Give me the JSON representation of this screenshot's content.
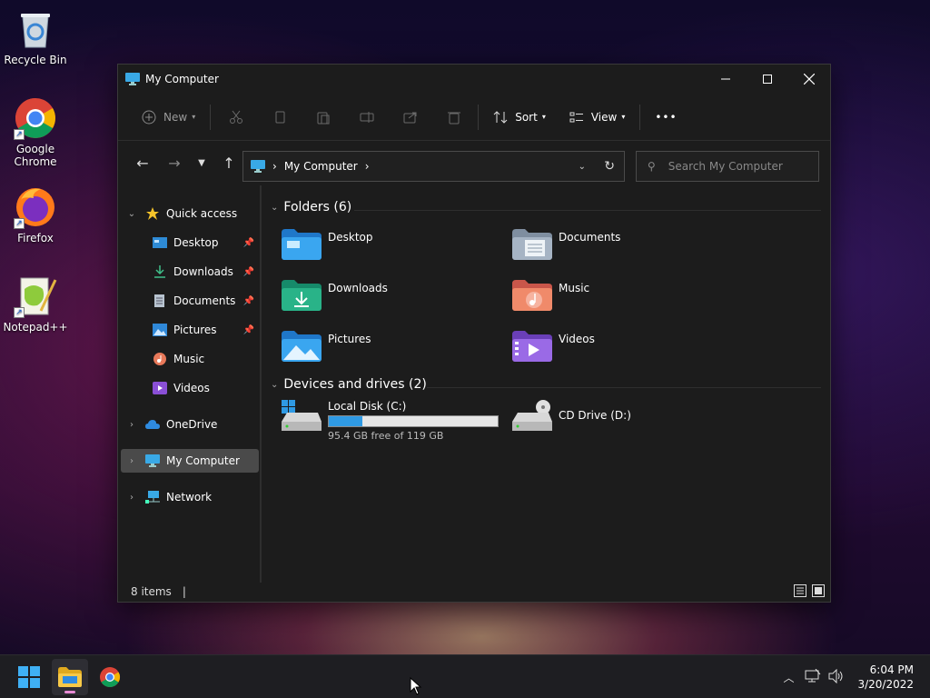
{
  "desktop": {
    "icons": [
      {
        "label": "Recycle Bin"
      },
      {
        "label": "Google Chrome"
      },
      {
        "label": "Firefox"
      },
      {
        "label": "Notepad++"
      }
    ]
  },
  "window": {
    "title": "My Computer",
    "toolbar": {
      "new_label": "New",
      "sort_label": "Sort",
      "view_label": "View",
      "more_label": "•••"
    },
    "address": {
      "location": "My Computer",
      "separator": "›"
    },
    "search": {
      "placeholder": "Search My Computer"
    },
    "sidebar": {
      "quick_access": "Quick access",
      "items": [
        {
          "label": "Desktop",
          "pinned": true
        },
        {
          "label": "Downloads",
          "pinned": true
        },
        {
          "label": "Documents",
          "pinned": true
        },
        {
          "label": "Pictures",
          "pinned": true
        },
        {
          "label": "Music",
          "pinned": false
        },
        {
          "label": "Videos",
          "pinned": false
        }
      ],
      "onedrive": "OneDrive",
      "my_computer": "My Computer",
      "network": "Network"
    },
    "content": {
      "folders_header": "Folders (6)",
      "folders": [
        {
          "label": "Desktop"
        },
        {
          "label": "Documents"
        },
        {
          "label": "Downloads"
        },
        {
          "label": "Music"
        },
        {
          "label": "Pictures"
        },
        {
          "label": "Videos"
        }
      ],
      "drives_header": "Devices and drives (2)",
      "drives": [
        {
          "label": "Local Disk (C:)",
          "free_text": "95.4 GB free of 119 GB",
          "used_fraction": 0.2
        },
        {
          "label": "CD Drive (D:)"
        }
      ]
    },
    "status": {
      "items": "8 items",
      "cursor": "|"
    }
  },
  "taskbar": {
    "time": "6:04 PM",
    "date": "3/20/2022"
  },
  "colors": {
    "accent": "#2f9ae4",
    "window_bg": "#1c1c1c",
    "selected": "#4a4a4a"
  }
}
